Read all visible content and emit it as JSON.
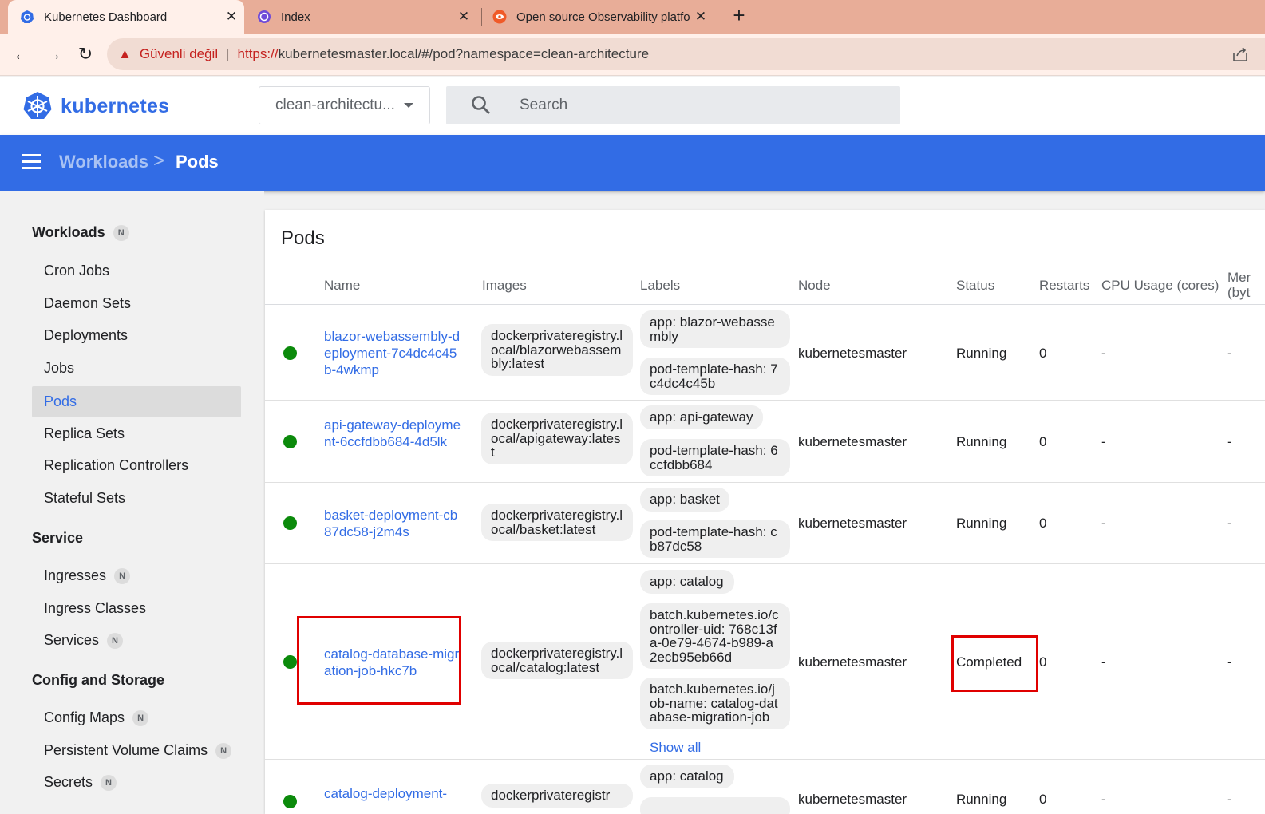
{
  "browser": {
    "tabs": [
      {
        "title": "Kubernetes Dashboard",
        "icon": "kubernetes-icon",
        "active": true
      },
      {
        "title": "Index",
        "icon": "blazor-icon",
        "active": false
      },
      {
        "title": "Open source Observability platfo",
        "icon": "observability-icon",
        "active": false
      }
    ],
    "security_label": "Güvenli değil",
    "url_scheme": "https://",
    "url_rest": "kubernetesmaster.local/#/pod?namespace=clean-architecture"
  },
  "header": {
    "logo_text": "kubernetes",
    "namespace": "clean-architectu...",
    "search_placeholder": "Search"
  },
  "breadcrumb": {
    "parent": "Workloads",
    "separator": ">",
    "current": "Pods"
  },
  "sidebar": {
    "workloads": {
      "title": "Workloads",
      "badge": "N"
    },
    "workload_items": [
      "Cron Jobs",
      "Daemon Sets",
      "Deployments",
      "Jobs",
      "Pods",
      "Replica Sets",
      "Replication Controllers",
      "Stateful Sets"
    ],
    "service": {
      "title": "Service"
    },
    "service_items": [
      {
        "label": "Ingresses",
        "badge": "N"
      },
      {
        "label": "Ingress Classes",
        "badge": ""
      },
      {
        "label": "Services",
        "badge": "N"
      }
    ],
    "config": {
      "title": "Config and Storage"
    },
    "config_items": [
      {
        "label": "Config Maps",
        "badge": "N"
      },
      {
        "label": "Persistent Volume Claims",
        "badge": "N"
      },
      {
        "label": "Secrets",
        "badge": "N"
      }
    ]
  },
  "table": {
    "title": "Pods",
    "columns": {
      "name": "Name",
      "images": "Images",
      "labels": "Labels",
      "node": "Node",
      "status": "Status",
      "restarts": "Restarts",
      "cpu": "CPU Usage (cores)",
      "memory_1": "Mer",
      "memory_2": "(byt"
    },
    "rows": [
      {
        "name": "blazor-webassembly-deployment-7c4dc4c45b-4wkmp",
        "image": "dockerprivateregistry.local/blazorwebassembly:latest",
        "labels": [
          "app: blazor-webassembly",
          "pod-template-hash: 7c4dc4c45b"
        ],
        "node": "kubernetesmaster",
        "status": "Running",
        "restarts": "0",
        "cpu": "-",
        "memory": "-"
      },
      {
        "name": "api-gateway-deployment-6ccfdbb684-4d5lk",
        "image": "dockerprivateregistry.local/apigateway:latest",
        "labels": [
          "app: api-gateway",
          "pod-template-hash: 6ccfdbb684"
        ],
        "node": "kubernetesmaster",
        "status": "Running",
        "restarts": "0",
        "cpu": "-",
        "memory": "-"
      },
      {
        "name": "basket-deployment-cb87dc58-j2m4s",
        "image": "dockerprivateregistry.local/basket:latest",
        "labels": [
          "app: basket",
          "pod-template-hash: cb87dc58"
        ],
        "node": "kubernetesmaster",
        "status": "Running",
        "restarts": "0",
        "cpu": "-",
        "memory": "-"
      },
      {
        "name": "catalog-database-migration-job-hkc7b",
        "image": "dockerprivateregistry.local/catalog:latest",
        "labels": [
          "app: catalog",
          "batch.kubernetes.io/controller-uid: 768c13fa-0e79-4674-b989-a2ecb95eb66d",
          "batch.kubernetes.io/job-name: catalog-database-migration-job"
        ],
        "show_all": "Show all",
        "node": "kubernetesmaster",
        "status": "Completed",
        "restarts": "0",
        "cpu": "-",
        "memory": "-"
      },
      {
        "name": "catalog-deployment-",
        "image": "dockerprivateregistr",
        "labels": [
          "app: catalog"
        ],
        "node": "kubernetesmaster",
        "status": "Running",
        "restarts": "0",
        "cpu": "-",
        "memory": "-"
      }
    ]
  },
  "colors": {
    "accent": "#326ce5",
    "status_running": "#0b8a0b",
    "highlight": "#e00000"
  }
}
